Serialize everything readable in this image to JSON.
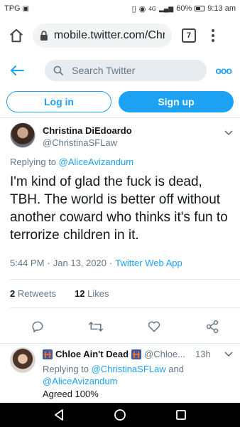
{
  "status": {
    "carrier": "TPG",
    "network": "4G",
    "battery": "60%",
    "time": "9:13 am"
  },
  "browser": {
    "url": "mobile.twitter.com/Chr",
    "tab_count": "7"
  },
  "header": {
    "search_placeholder": "Search Twitter",
    "more_label": "ooo"
  },
  "auth": {
    "login_label": "Log in",
    "signup_label": "Sign up"
  },
  "tweet": {
    "display_name": "Christina DiEdoardo",
    "handle": "@ChristinaSFLaw",
    "replying_prefix": "Replying to",
    "replying_to": "@AliceAvizandum",
    "text": "I'm kind of glad the fuck is dead, TBH.  The world is better off without another coward who thinks it's fun to terrorize children in it.",
    "time": "5:44 PM",
    "date": "Jan 13, 2020",
    "source": "Twitter Web App",
    "retweets_count": "2",
    "retweets_label": "Retweets",
    "likes_count": "12",
    "likes_label": "Likes"
  },
  "reply": {
    "display_name": "Chloe Ain't Dead",
    "handle": "@Chloe...",
    "time": "13h",
    "replying_prefix": "Replying to",
    "replying_to_1": "@ChristinaSFLaw",
    "and": "and",
    "replying_to_2": "@AliceAvizandum",
    "text": "Agreed 100%"
  },
  "colors": {
    "accent": "#1da1f2",
    "muted": "#657786",
    "text": "#14171a"
  },
  "icons": [
    "home-icon",
    "lock-icon",
    "back-arrow-icon",
    "search-icon",
    "reply-icon",
    "retweet-icon",
    "like-icon",
    "share-icon",
    "chevron-down-icon",
    "nav-back-icon",
    "nav-home-icon",
    "nav-recents-icon"
  ]
}
